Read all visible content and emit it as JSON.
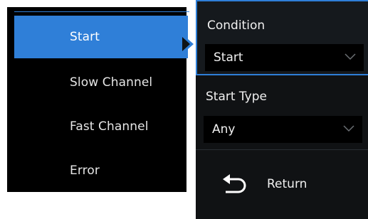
{
  "menu": {
    "items": [
      {
        "label": "Start",
        "selected": true
      },
      {
        "label": "Slow Channel",
        "selected": false
      },
      {
        "label": "Fast Channel",
        "selected": false
      },
      {
        "label": "Error",
        "selected": false
      }
    ]
  },
  "panel": {
    "condition": {
      "label": "Condition",
      "value": "Start",
      "icon": "chevron-down-icon"
    },
    "start_type": {
      "label": "Start Type",
      "value": "Any",
      "icon": "chevron-down-icon"
    },
    "return": {
      "label": "Return",
      "icon": "return-arrow-icon"
    }
  },
  "colors": {
    "accent": "#2f7fd8",
    "menu_bg": "#000000",
    "panel_bg": "#101214",
    "text": "#f0f0f0"
  }
}
